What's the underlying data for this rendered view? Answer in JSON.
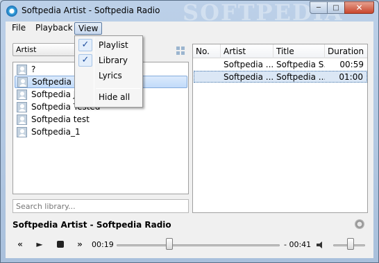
{
  "window": {
    "title": "Softpedia Artist - Softpedia Radio",
    "watermark": "SOFTPEDIA",
    "buttons": {
      "minimize": "─",
      "maximize": "□",
      "close": "✕"
    }
  },
  "menubar": {
    "items": [
      "File",
      "Playback",
      "View"
    ]
  },
  "view_menu": {
    "items": [
      {
        "label": "Playlist",
        "check": "✓"
      },
      {
        "label": "Library",
        "check": "✓"
      },
      {
        "label": "Lyrics"
      },
      {
        "label": "Hide all"
      }
    ]
  },
  "library": {
    "group_by": "Artist",
    "items": [
      {
        "label": "?"
      },
      {
        "label": "Softpedia Artist",
        "selected": true
      },
      {
        "label": "Softpedia Jo"
      },
      {
        "label": "Softpedia Tested"
      },
      {
        "label": "Softpedia test"
      },
      {
        "label": "Softpedia_1"
      }
    ],
    "search_placeholder": "Search library..."
  },
  "playlist": {
    "columns": [
      "No.",
      "Artist",
      "Title",
      "Duration"
    ],
    "rows": [
      {
        "no": "",
        "artist": "Softpedia ...",
        "title": "Softpedia S...",
        "duration": "00:59"
      },
      {
        "no": "",
        "artist": "Softpedia ...",
        "title": "Softpedia ...",
        "duration": "01:00",
        "selected": true
      }
    ]
  },
  "player": {
    "now_playing": "Softpedia Artist - Softpedia Radio",
    "elapsed": "00:19",
    "remaining": "- 00:41",
    "controls": {
      "prev": "«",
      "play": "►",
      "next": "»"
    }
  }
}
